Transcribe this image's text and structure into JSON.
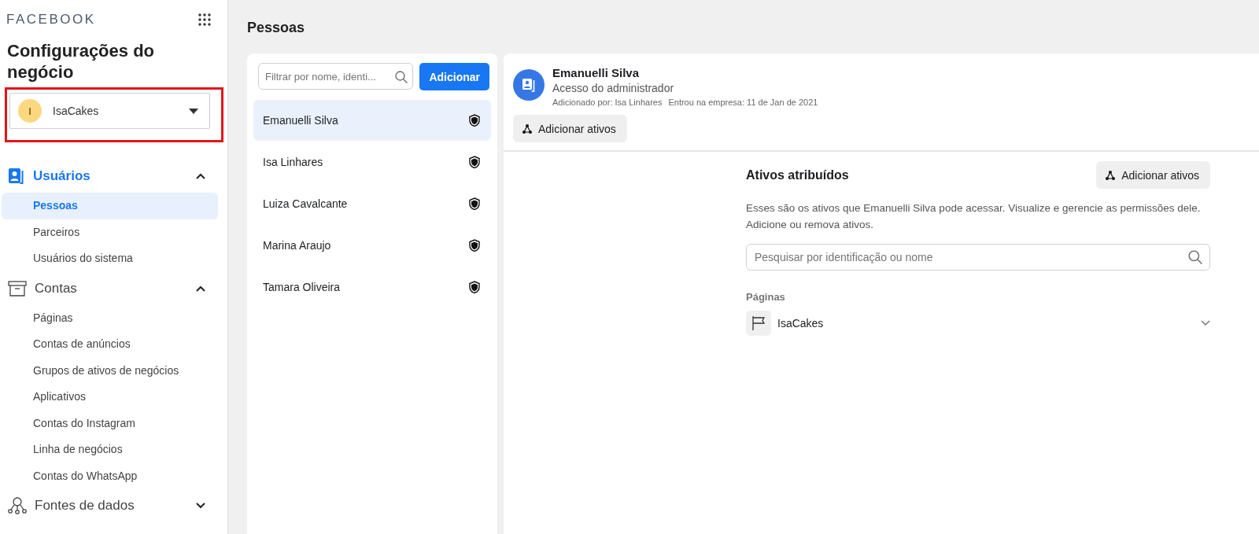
{
  "sidebar": {
    "brand": "FACEBOOK",
    "title": "Configurações do negócio",
    "account": {
      "initial": "I",
      "name": "IsaCakes"
    },
    "sections": [
      {
        "label": "Usuários",
        "expanded": true,
        "selected": true,
        "items": [
          {
            "label": "Pessoas",
            "selected": true
          },
          {
            "label": "Parceiros",
            "selected": false
          },
          {
            "label": "Usuários do sistema",
            "selected": false
          }
        ]
      },
      {
        "label": "Contas",
        "expanded": true,
        "selected": false,
        "items": [
          {
            "label": "Páginas",
            "selected": false
          },
          {
            "label": "Contas de anúncios",
            "selected": false
          },
          {
            "label": "Grupos de ativos de negócios",
            "selected": false
          },
          {
            "label": "Aplicativos",
            "selected": false
          },
          {
            "label": "Contas do Instagram",
            "selected": false
          },
          {
            "label": "Linha de negócios",
            "selected": false
          },
          {
            "label": "Contas do WhatsApp",
            "selected": false
          }
        ]
      },
      {
        "label": "Fontes de dados",
        "expanded": false,
        "selected": false
      }
    ]
  },
  "page_title": "Pessoas",
  "people_list": {
    "filter": {
      "placeholder": "Filtrar por nome, identi..."
    },
    "add_button": "Adicionar",
    "people": [
      {
        "name": "Emanuelli Silva",
        "selected": true
      },
      {
        "name": "Isa Linhares",
        "selected": false
      },
      {
        "name": "Luiza Cavalcante",
        "selected": false
      },
      {
        "name": "Marina Araujo",
        "selected": false
      },
      {
        "name": "Tamara Oliveira",
        "selected": false
      }
    ]
  },
  "detail": {
    "name": "Emanuelli Silva",
    "role": "Acesso do administrador",
    "added_by": "Adicionado por: Isa Linhares",
    "joined": "Entrou na empresa: 11 de Jan de 2021",
    "add_assets_button": "Adicionar ativos",
    "assets": {
      "title": "Ativos atribuídos",
      "add_assets_button": "Adicionar ativos",
      "description": "Esses são os ativos que Emanuelli Silva pode acessar. Visualize e gerencie as permissões dele. Adicione ou remova ativos.",
      "search": {
        "placeholder": "Pesquisar por identificação ou nome"
      },
      "groups": [
        {
          "label": "Páginas",
          "items": [
            {
              "name": "IsaCakes"
            }
          ]
        }
      ]
    }
  }
}
